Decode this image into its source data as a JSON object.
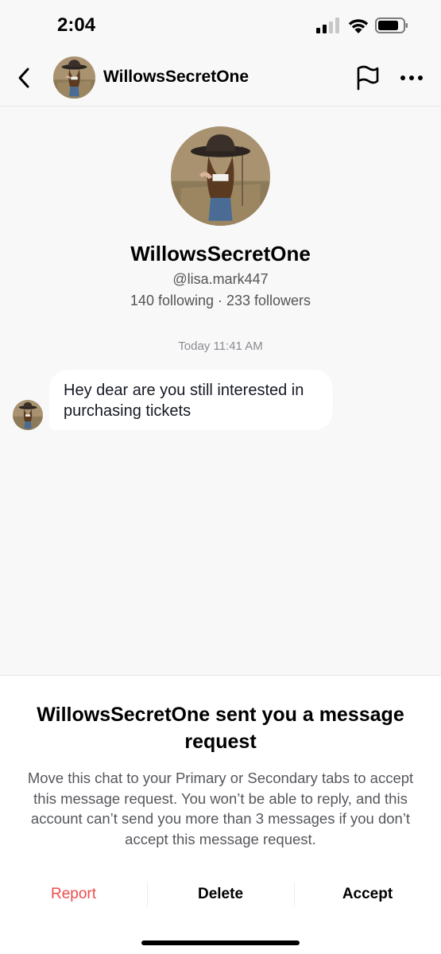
{
  "status_bar": {
    "time": "2:04"
  },
  "header": {
    "name": "WillowsSecretOne"
  },
  "profile": {
    "name": "WillowsSecretOne",
    "handle": "@lisa.mark447",
    "stats": "140 following · 233 followers"
  },
  "conversation": {
    "timestamp": "Today 11:41 AM",
    "messages": [
      {
        "text": "Hey dear are you still interested in purchasing tickets"
      }
    ]
  },
  "request_sheet": {
    "title": "WillowsSecretOne sent you a message request",
    "body": "Move this chat to your Primary or Secondary tabs to accept this message request. You won’t be able to reply, and this account can’t send you more than 3 messages if you don’t accept this message request.",
    "actions": {
      "report": "Report",
      "delete": "Delete",
      "accept": "Accept"
    }
  },
  "colors": {
    "report": "#ee4d4d",
    "background": "#f8f8f8",
    "bubble": "#ffffff"
  },
  "icons": [
    "signal-icon",
    "wifi-icon",
    "battery-icon",
    "back-chevron-icon",
    "flag-icon",
    "more-dots-icon"
  ]
}
